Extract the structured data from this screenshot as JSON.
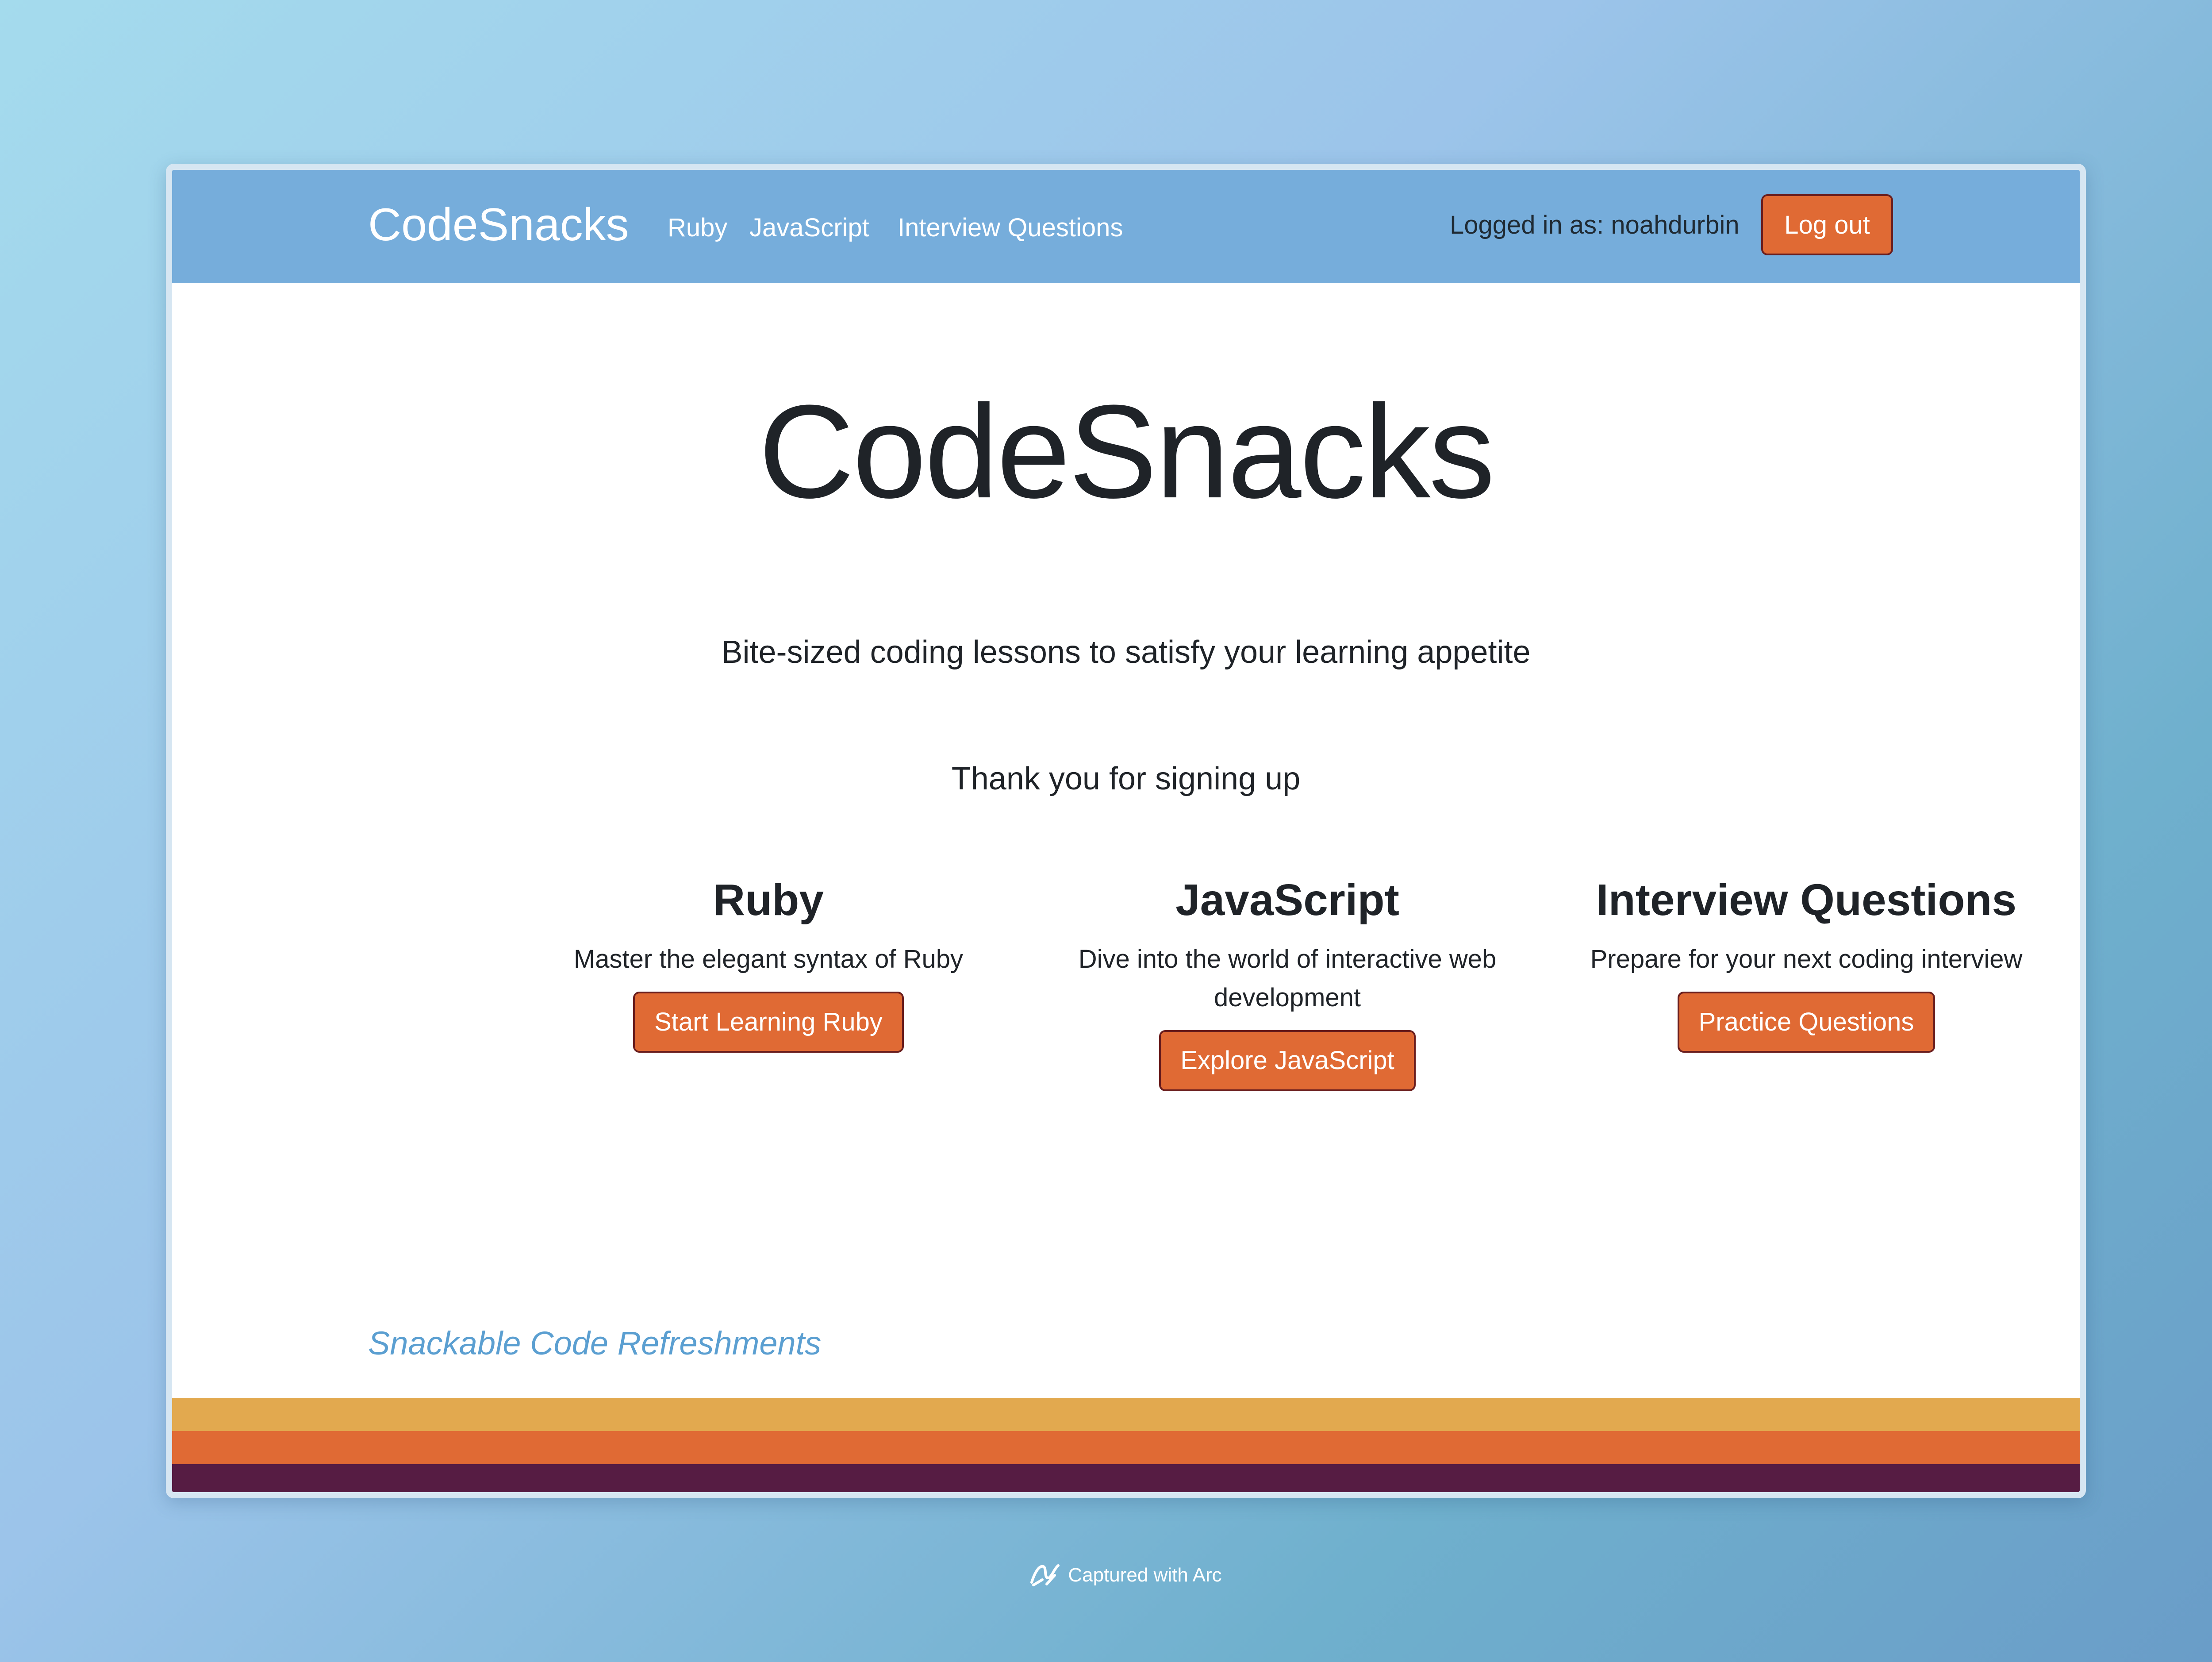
{
  "navbar": {
    "brand": "CodeSnacks",
    "links": [
      "Ruby",
      "JavaScript",
      "Interview Questions"
    ],
    "logged_in_text": "Logged in as: noahdurbin",
    "logout_label": "Log out"
  },
  "hero": {
    "title": "CodeSnacks",
    "subtitle": "Bite-sized coding lessons to satisfy your learning appetite",
    "message": "Thank you for signing up"
  },
  "cards": [
    {
      "title": "Ruby",
      "description": "Master the elegant syntax of Ruby",
      "button": "Start Learning Ruby"
    },
    {
      "title": "JavaScript",
      "description": "Dive into the world of interactive web development",
      "button": "Explore JavaScript"
    },
    {
      "title": "Interview Questions",
      "description": "Prepare for your next coding interview",
      "button": "Practice Questions"
    }
  ],
  "footer": {
    "tagline": "Snackable Code Refreshments"
  },
  "capture_label": "Captured with Arc",
  "colors": {
    "navbar": "#76addb",
    "accent_button": "#e06a34",
    "stripe_yellow": "#e2a94f",
    "stripe_orange": "#e06a34",
    "stripe_purple": "#561c43",
    "tagline": "#5b9fd1"
  }
}
